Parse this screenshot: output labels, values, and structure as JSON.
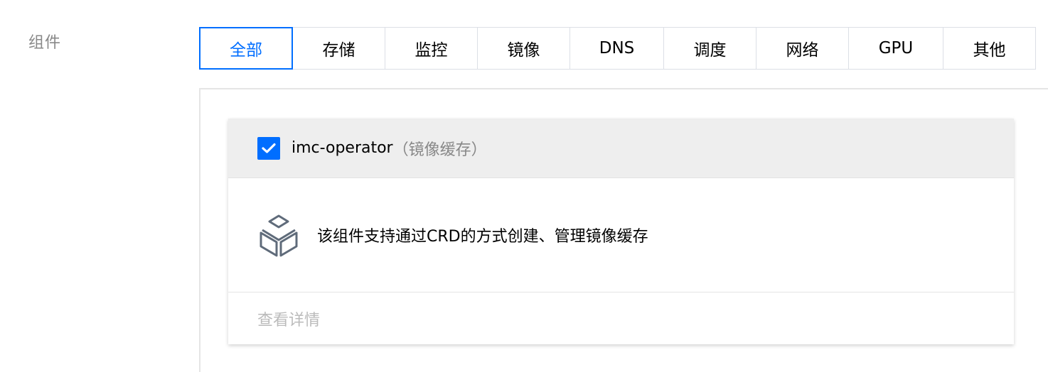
{
  "section_label": "组件",
  "tabs": [
    {
      "label": "全部",
      "active": true
    },
    {
      "label": "存储",
      "active": false
    },
    {
      "label": "监控",
      "active": false
    },
    {
      "label": "镜像",
      "active": false
    },
    {
      "label": "DNS",
      "active": false
    },
    {
      "label": "调度",
      "active": false
    },
    {
      "label": "网络",
      "active": false
    },
    {
      "label": "GPU",
      "active": false
    },
    {
      "label": "其他",
      "active": false
    }
  ],
  "card": {
    "checked": true,
    "name": "imc-operator",
    "category": "（镜像缓存）",
    "icon": "box-icon",
    "description": "该组件支持通过CRD的方式创建、管理镜像缓存",
    "detail_link": "查看详情"
  },
  "colors": {
    "accent": "#006eff",
    "muted_text": "#888888",
    "header_bg": "#eeeeee",
    "border": "#dcdfe6"
  }
}
